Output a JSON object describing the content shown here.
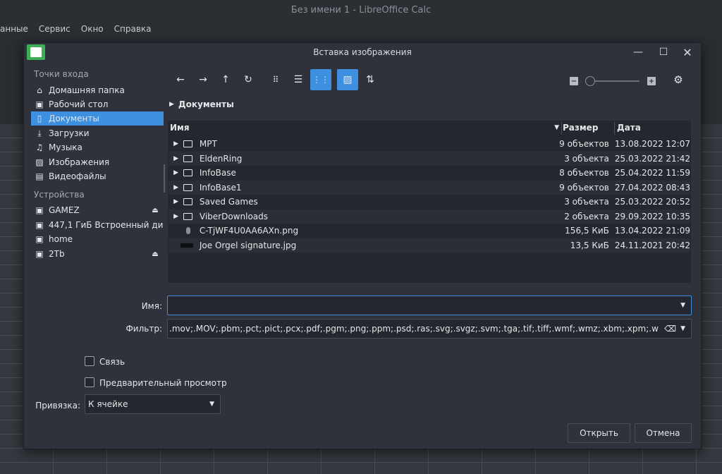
{
  "background_app": {
    "window_title": "Без имени 1 - LibreOffice Calc",
    "menu": [
      "анные",
      "Сервис",
      "Окно",
      "Справка"
    ]
  },
  "dialog": {
    "title": "Вставка изображения",
    "sidebar": {
      "places_header": "Точки входа",
      "places": [
        {
          "label": "Домашняя папка",
          "icon": "home-icon"
        },
        {
          "label": "Рабочий стол",
          "icon": "desktop-icon"
        },
        {
          "label": "Документы",
          "icon": "document-icon",
          "selected": true
        },
        {
          "label": "Загрузки",
          "icon": "download-icon"
        },
        {
          "label": "Музыка",
          "icon": "music-icon"
        },
        {
          "label": "Изображения",
          "icon": "image-icon"
        },
        {
          "label": "Видеофайлы",
          "icon": "video-icon"
        }
      ],
      "devices_header": "Устройства",
      "devices": [
        {
          "label": "GAMEZ",
          "icon": "drive-icon",
          "ejectable": true
        },
        {
          "label": "447,1 ГиБ Встроенный ди...",
          "icon": "drive-icon",
          "ejectable": false
        },
        {
          "label": "home",
          "icon": "drive-icon",
          "ejectable": false
        },
        {
          "label": "2Tb",
          "icon": "drive-icon",
          "ejectable": true
        }
      ]
    },
    "breadcrumb": "Документы",
    "columns": {
      "name": "Имя",
      "size": "Размер",
      "date": "Дата"
    },
    "files": [
      {
        "name": "MPT",
        "size": "9 объектов",
        "date": "13.08.2022 12:07",
        "type": "folder"
      },
      {
        "name": "EldenRing",
        "size": "3 объекта",
        "date": "25.03.2022 21:42",
        "type": "folder"
      },
      {
        "name": "InfoBase",
        "size": "8 объектов",
        "date": "25.04.2022 11:59",
        "type": "folder"
      },
      {
        "name": "InfoBase1",
        "size": "9 объектов",
        "date": "27.04.2022 08:43",
        "type": "folder"
      },
      {
        "name": "Saved Games",
        "size": "3 объекта",
        "date": "25.03.2022 20:52",
        "type": "folder"
      },
      {
        "name": "ViberDownloads",
        "size": "2 объекта",
        "date": "29.09.2022 10:35",
        "type": "folder"
      },
      {
        "name": "C-TjWF4U0AA6AXn.png",
        "size": "156,5 КиБ",
        "date": "13.04.2022 21:09",
        "type": "image"
      },
      {
        "name": "Joe Orgel signature.jpg",
        "size": "13,5 КиБ",
        "date": "24.11.2021 20:42",
        "type": "image"
      }
    ],
    "name_label": "Имя:",
    "name_value": "",
    "filter_label": "Фильтр:",
    "filter_value": ".mov;.MOV;.pbm;.pct;.pict;.pcx;.pdf;.pgm;.png;.ppm;.psd;.ras;.svg;.svgz;.svm;.tga;.tif;.tiff;.wmf;.wmz;.xbm;.xpm;.webp;.pcd)",
    "link_label": "Связь",
    "preview_label": "Предварительный просмотр",
    "anchor_label": "Привязка:",
    "anchor_value": "К ячейке",
    "open_button": "Открыть",
    "cancel_button": "Отмена",
    "accent_color": "#3d8fe0"
  }
}
